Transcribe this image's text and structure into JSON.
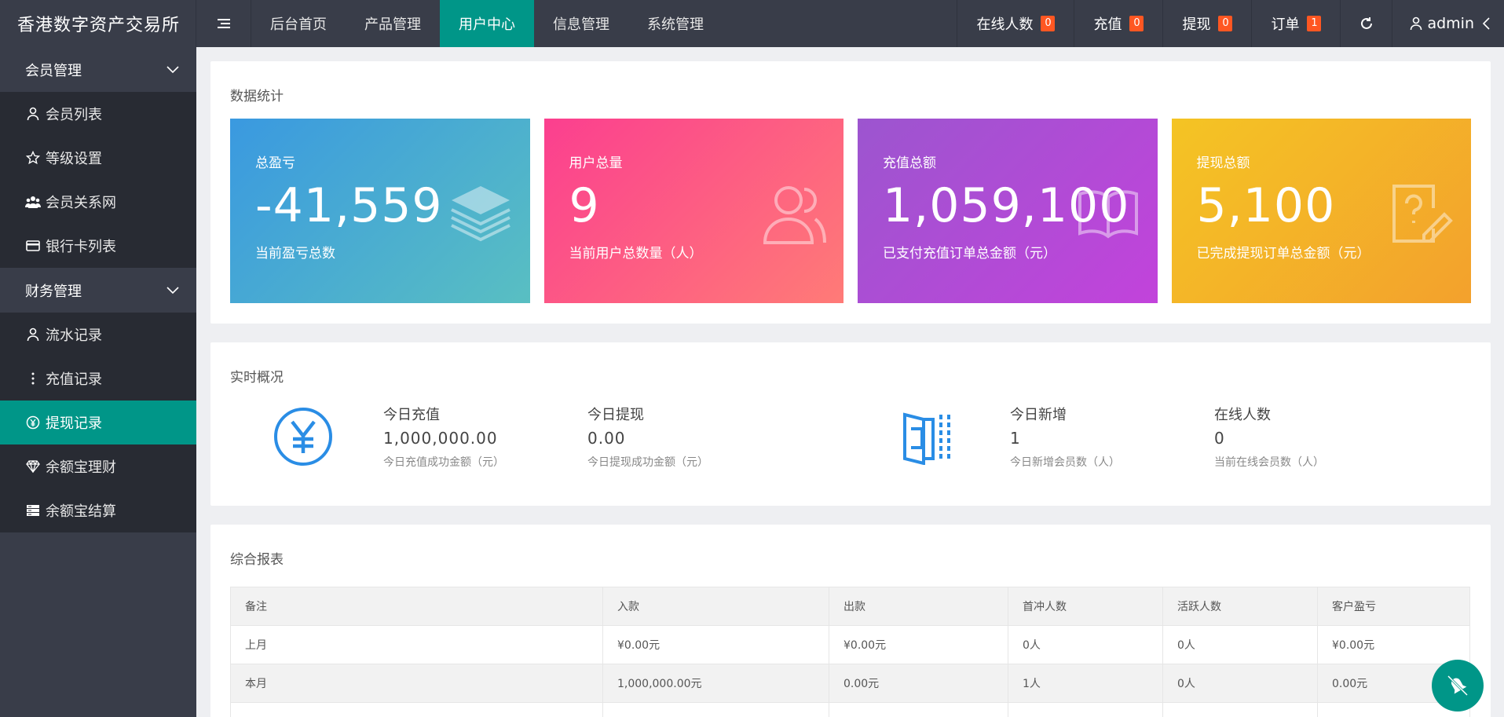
{
  "app": {
    "title": "香港数字资产交易所"
  },
  "nav": {
    "items": [
      {
        "label": "后台首页"
      },
      {
        "label": "产品管理"
      },
      {
        "label": "用户中心",
        "active": true
      },
      {
        "label": "信息管理"
      },
      {
        "label": "系统管理"
      }
    ]
  },
  "topstats": {
    "online": {
      "label": "在线人数",
      "count": "0"
    },
    "recharge": {
      "label": "充值",
      "count": "0"
    },
    "withdraw": {
      "label": "提现",
      "count": "0"
    },
    "orders": {
      "label": "订单",
      "count": "1"
    }
  },
  "user": {
    "name": "admin"
  },
  "sidebar": {
    "groups": [
      {
        "label": "会员管理",
        "items": [
          {
            "label": "会员列表",
            "icon": "user-icon"
          },
          {
            "label": "等级设置",
            "icon": "star-icon"
          },
          {
            "label": "会员关系网",
            "icon": "users-icon"
          },
          {
            "label": "银行卡列表",
            "icon": "card-icon"
          }
        ]
      },
      {
        "label": "财务管理",
        "items": [
          {
            "label": "流水记录",
            "icon": "user-icon"
          },
          {
            "label": "充值记录",
            "icon": "more-vertical-icon"
          },
          {
            "label": "提现记录",
            "icon": "yen-icon",
            "active": true
          },
          {
            "label": "余额宝理财",
            "icon": "diamond-icon"
          },
          {
            "label": "余额宝结算",
            "icon": "server-icon"
          }
        ]
      }
    ]
  },
  "stats": {
    "title": "数据统计",
    "tiles": [
      {
        "label": "总盈亏",
        "value": "-41,559",
        "desc": "当前盈亏总数",
        "icon": "layers-icon"
      },
      {
        "label": "用户总量",
        "value": "9",
        "desc": "当前用户总数量（人）",
        "icon": "users-icon"
      },
      {
        "label": "充值总额",
        "value": "1,059,100",
        "desc": "已支付充值订单总金额（元）",
        "icon": "book-icon"
      },
      {
        "label": "提现总额",
        "value": "5,100",
        "desc": "已完成提现订单总金额（元）",
        "icon": "help-edit-icon"
      }
    ]
  },
  "realtime": {
    "title": "实时概况",
    "blocks": [
      {
        "label": "今日充值",
        "value": "1,000,000.00",
        "desc": "今日充值成功金额（元）"
      },
      {
        "label": "今日提现",
        "value": "0.00",
        "desc": "今日提现成功金额（元）"
      },
      {
        "label": "今日新增",
        "value": "1",
        "desc": "今日新增会员数（人）"
      },
      {
        "label": "在线人数",
        "value": "0",
        "desc": "当前在线会员数（人）"
      }
    ]
  },
  "report": {
    "title": "综合报表",
    "columns": [
      "备注",
      "入款",
      "出款",
      "首冲人数",
      "活跃人数",
      "客户盈亏"
    ],
    "rows": [
      [
        "上月",
        "¥0.00元",
        "¥0.00元",
        "0人",
        "0人",
        "¥0.00元"
      ],
      [
        "本月",
        "1,000,000.00元",
        "0.00元",
        "1人",
        "0人",
        "0.00元"
      ]
    ]
  }
}
